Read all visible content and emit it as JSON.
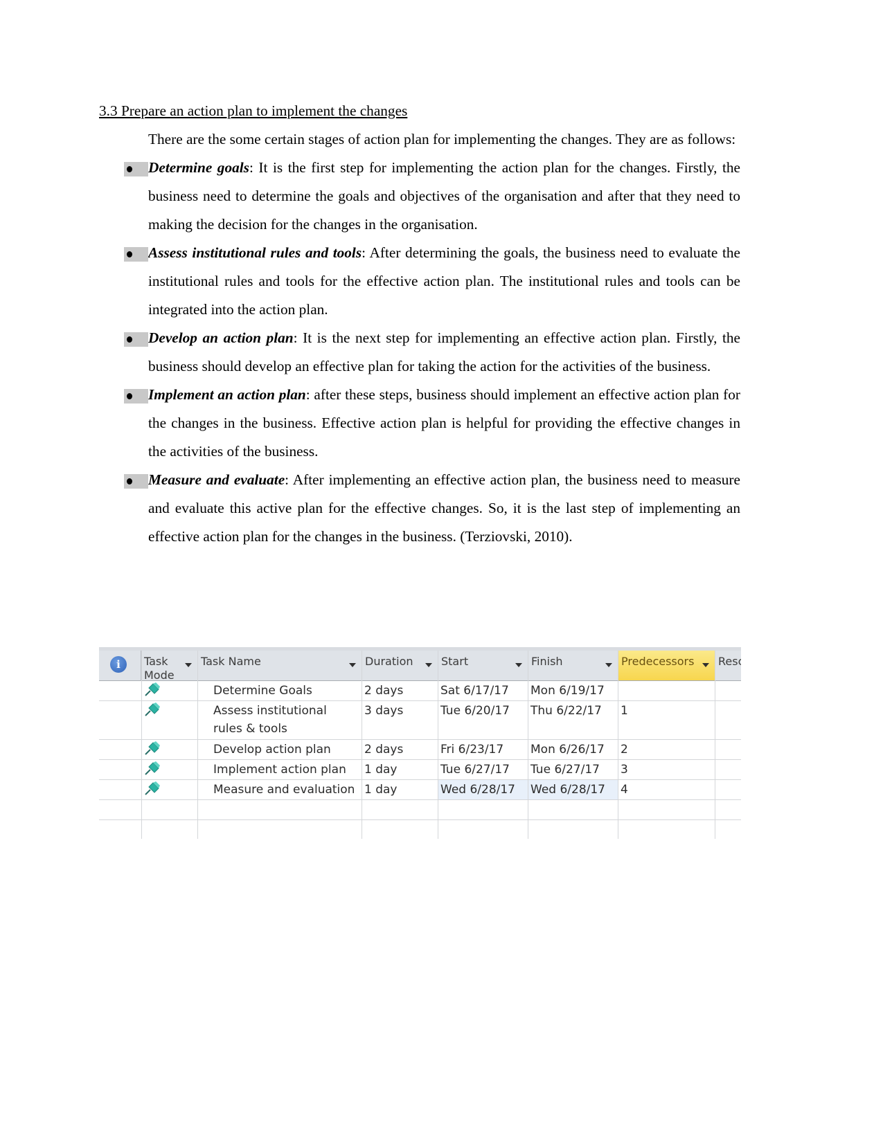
{
  "heading": "3.3 Prepare an action plan to implement the changes",
  "intro": "There are the some certain stages of action plan for implementing the changes. They are as follows:",
  "steps": [
    {
      "term": "Determine goals",
      "text": ": It is the first step for implementing the action plan for the changes. Firstly, the business need to determine the goals and objectives of the organisation and after that they need to making the decision for the changes in the organisation."
    },
    {
      "term": "Assess institutional rules and tools",
      "text": ": After determining the goals, the business need to evaluate the institutional rules and tools for the effective action plan. The institutional rules and tools can be integrated into the action plan."
    },
    {
      "term": "Develop an action plan",
      "text": ":  It is the next step for implementing an effective action plan. Firstly, the business should develop an effective plan for taking the action for the activities of the business."
    },
    {
      "term": "Implement an action plan",
      "text": ": after these steps, business should implement an effective action plan for the changes in the business. Effective action plan is helpful for providing the effective changes in the activities of the business."
    },
    {
      "term": "Measure and evaluate",
      "text": ": After implementing an effective action plan, the business need to measure and evaluate this active plan for the effective changes. So, it is the last step of implementing an effective action plan for the changes in the business.  (Terziovski, 2010)."
    }
  ],
  "table": {
    "info_icon": "information-icon",
    "columns": {
      "task_mode": "Task Mode",
      "task_name": "Task Name",
      "duration": "Duration",
      "start": "Start",
      "finish": "Finish",
      "predecessors": "Predecessors",
      "resources": "Resc"
    },
    "task_mode_icon": "manual-pin-icon",
    "rows": [
      {
        "name": "Determine Goals",
        "duration": "2 days",
        "start": "Sat 6/17/17",
        "finish": "Mon 6/19/17",
        "predecessors": ""
      },
      {
        "name": "Assess institutional rules & tools",
        "duration": "3 days",
        "start": "Tue 6/20/17",
        "finish": "Thu 6/22/17",
        "predecessors": "1"
      },
      {
        "name": "Develop action plan",
        "duration": "2 days",
        "start": "Fri 6/23/17",
        "finish": "Mon 6/26/17",
        "predecessors": "2"
      },
      {
        "name": "Implement action plan",
        "duration": "1 day",
        "start": "Tue 6/27/17",
        "finish": "Tue 6/27/17",
        "predecessors": "3"
      },
      {
        "name": "Measure and evaluation",
        "duration": "1 day",
        "start": "Wed 6/28/17",
        "finish": "Wed 6/28/17",
        "predecessors": "4"
      }
    ],
    "colors": {
      "header_bg": "#dfe3e8",
      "predecessors_header": "#f7d64e",
      "pin": "#2bb3a3",
      "selected_cells": "#e8f0fa"
    }
  }
}
